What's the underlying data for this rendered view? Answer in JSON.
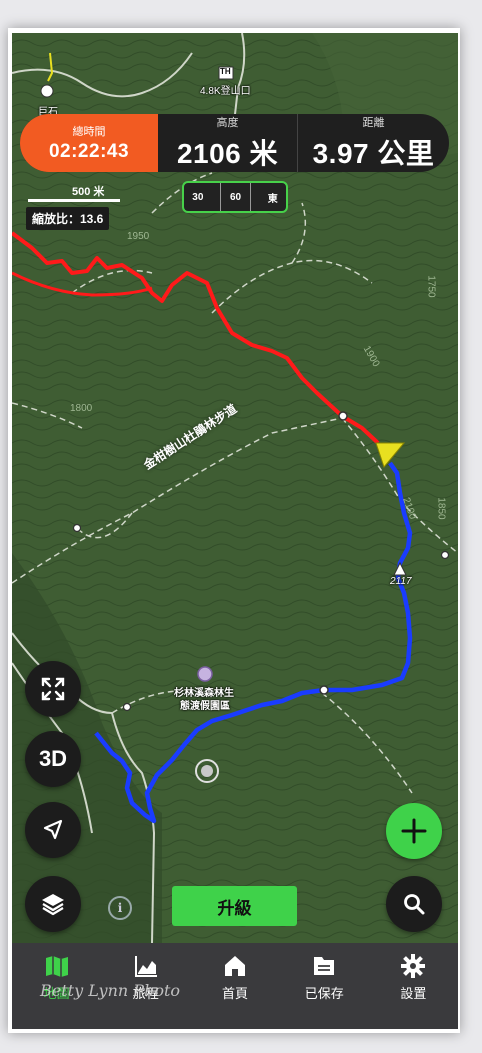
{
  "stats": {
    "total_time_label": "總時間",
    "total_time_value": "02:22:43",
    "altitude_label": "高度",
    "altitude_value": "2106 米",
    "distance_label": "距離",
    "distance_value": "3.97 公里"
  },
  "map": {
    "scale_label": "500 米",
    "zoom_label": "縮放比：13.6",
    "compass": {
      "left": "30",
      "mid": "60",
      "right": "東"
    },
    "labels": {
      "trailhead": "4.8K登山口",
      "th_badge": "TH",
      "place_top": "巨石",
      "trail_name": "金柑樹山杜鵑林步道",
      "peak_elev": "2117",
      "contour_1950": "1950",
      "contour_1900": "1900",
      "contour_1800": "1800",
      "contour_1750": "1750",
      "contour_1850": "1850",
      "contour_2100": "2100",
      "forest_area_line1": "杉林溪森林生",
      "forest_area_line2": "態渡假園區"
    }
  },
  "controls": {
    "three_d_label": "3D",
    "upgrade_label": "升級"
  },
  "nav": {
    "items": [
      {
        "label": "地圖",
        "icon": "map-icon"
      },
      {
        "label": "旅程",
        "icon": "chart-icon"
      },
      {
        "label": "首頁",
        "icon": "home-icon"
      },
      {
        "label": "已保存",
        "icon": "saved-icon"
      },
      {
        "label": "設置",
        "icon": "gear-icon"
      }
    ]
  },
  "watermark": "Betty Lynn Photo",
  "colors": {
    "accent_orange": "#f25b22",
    "accent_green": "#3fd24a",
    "track_red": "#ff1a1a",
    "track_blue": "#1a3cff",
    "map_green": "#3d5a31"
  }
}
